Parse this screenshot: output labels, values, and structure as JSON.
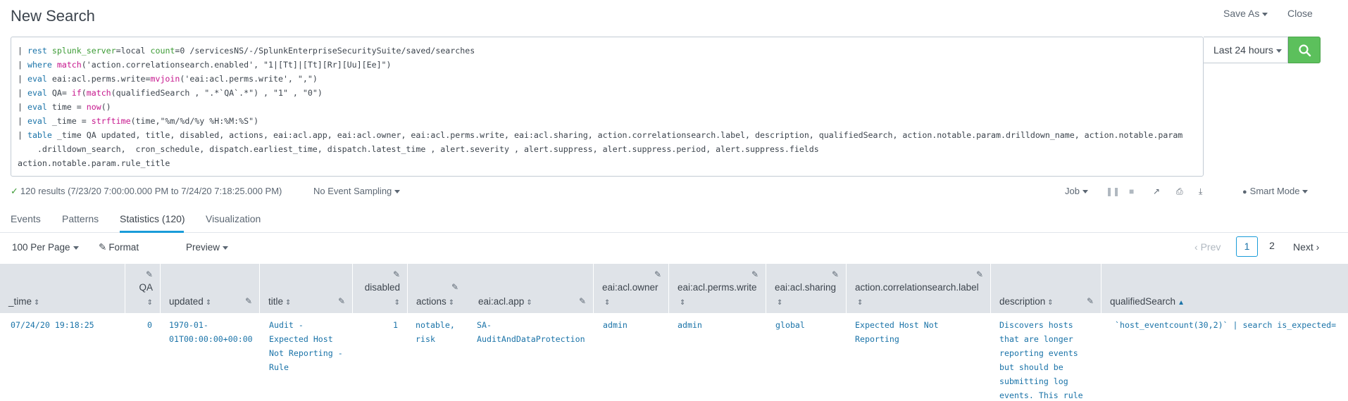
{
  "header": {
    "title": "New Search",
    "save_as": "Save As",
    "close": "Close"
  },
  "query": {
    "lines": [
      [
        {
          "t": "| "
        },
        {
          "t": "rest",
          "c": "cmd"
        },
        {
          "t": " "
        },
        {
          "t": "splunk_server",
          "c": "arg"
        },
        {
          "t": "=local "
        },
        {
          "t": "count",
          "c": "arg"
        },
        {
          "t": "=0 /servicesNS/-/SplunkEnterpriseSecuritySuite/saved/searches"
        }
      ],
      [
        {
          "t": "| "
        },
        {
          "t": "where",
          "c": "cmd"
        },
        {
          "t": " "
        },
        {
          "t": "match",
          "c": "fn"
        },
        {
          "t": "('action.correlationsearch.enabled', \"1|[Tt]|[Tt][Rr][Uu][Ee]\")"
        }
      ],
      [
        {
          "t": "| "
        },
        {
          "t": "eval",
          "c": "cmd"
        },
        {
          "t": " eai:acl.perms.write="
        },
        {
          "t": "mvjoin",
          "c": "fn"
        },
        {
          "t": "('eai:acl.perms.write', \",\")"
        }
      ],
      [
        {
          "t": "| "
        },
        {
          "t": "eval",
          "c": "cmd"
        },
        {
          "t": " QA= "
        },
        {
          "t": "if",
          "c": "fn"
        },
        {
          "t": "("
        },
        {
          "t": "match",
          "c": "fn"
        },
        {
          "t": "(qualifiedSearch , \".*`QA`.*\") , \"1\" , \"0\")"
        }
      ],
      [
        {
          "t": "| "
        },
        {
          "t": "eval",
          "c": "cmd"
        },
        {
          "t": " time = "
        },
        {
          "t": "now",
          "c": "fn"
        },
        {
          "t": "()"
        }
      ],
      [
        {
          "t": "| "
        },
        {
          "t": "eval",
          "c": "cmd"
        },
        {
          "t": " _time = "
        },
        {
          "t": "strftime",
          "c": "fn"
        },
        {
          "t": "(time,\"%m/%d/%y %H:%M:%S\")"
        }
      ],
      [
        {
          "t": "| "
        },
        {
          "t": "table",
          "c": "cmd"
        },
        {
          "t": " _time QA updated, title, disabled, actions, eai:acl.app, eai:acl.owner, eai:acl.perms.write, eai:acl.sharing, action.correlationsearch.label, description, qualifiedSearch, action.notable.param.drilldown_name, action.notable.param"
        }
      ],
      [
        {
          "t": "    .drilldown_search,  cron_schedule, dispatch.earliest_time, dispatch.latest_time , alert.severity , alert.suppress, alert.suppress.period, alert.suppress.fields"
        }
      ],
      [
        {
          "t": "action.notable.param.rule_title"
        }
      ]
    ]
  },
  "time_picker": {
    "label": "Last 24 hours"
  },
  "status": {
    "results": "120 results (7/23/20 7:00:00.000 PM to 7/24/20 7:18:25.000 PM)",
    "sampling": "No Event Sampling",
    "job": "Job",
    "mode": "Smart Mode"
  },
  "tabs": [
    {
      "label": "Events"
    },
    {
      "label": "Patterns"
    },
    {
      "label": "Statistics (120)"
    },
    {
      "label": "Visualization"
    }
  ],
  "controls": {
    "per_page": "100 Per Page",
    "format": "Format",
    "preview": "Preview",
    "prev": "Prev",
    "next": "Next",
    "pages": [
      "1",
      "2"
    ]
  },
  "columns": [
    {
      "label": "_time"
    },
    {
      "label": "QA"
    },
    {
      "label": "updated"
    },
    {
      "label": "title"
    },
    {
      "label": "disabled"
    },
    {
      "label": "actions"
    },
    {
      "label": "eai:acl.app"
    },
    {
      "label": "eai:acl.owner"
    },
    {
      "label": "eai:acl.perms.write"
    },
    {
      "label": "eai:acl.sharing"
    },
    {
      "label": "action.correlationsearch.label"
    },
    {
      "label": "description"
    },
    {
      "label": "qualifiedSearch"
    }
  ],
  "row": {
    "time": "07/24/20 19:18:25",
    "qa": "0",
    "updated": "1970-01-\n01T00:00:00+00:00",
    "title": "Audit -\nExpected Host\nNot Reporting -\nRule",
    "disabled": "1",
    "actions": "notable,\nrisk",
    "app": "SA-\nAuditAndDataProtection",
    "owner": "admin",
    "perms_write": "admin",
    "sharing": "global",
    "label": "Expected Host Not\nReporting",
    "description": "Discovers hosts\nthat are longer\nreporting events\nbut should be\nsubmitting log\nevents. This rule",
    "qualified_search": "`host_eventcount(30,2)` | search is_expected="
  },
  "colors": {
    "accent": "#1a9cd9",
    "search_button": "#5cc05c",
    "link": "#1a73a8",
    "header_bg": "#dfe3e8"
  }
}
